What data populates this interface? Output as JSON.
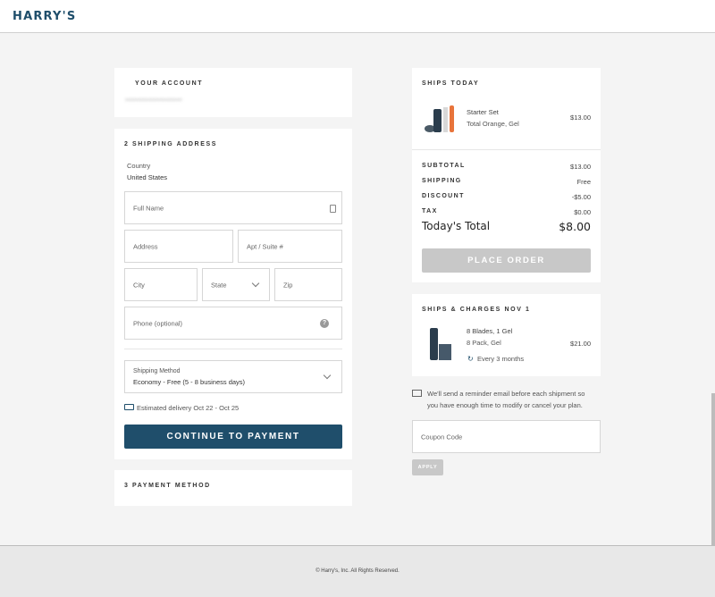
{
  "brand": {
    "logo": "HARRY'S"
  },
  "account": {
    "heading": "YOUR ACCOUNT",
    "email": "••••••••••••••••••••••••••"
  },
  "shipping": {
    "heading": "2  SHIPPING ADDRESS",
    "country_label": "Country",
    "country_value": "United States",
    "full_name_placeholder": "Full Name",
    "address_placeholder": "Address",
    "apt_placeholder": "Apt / Suite #",
    "city_placeholder": "City",
    "state_placeholder": "State",
    "zip_placeholder": "Zip",
    "phone_placeholder": "Phone (optional)",
    "method_label": "Shipping Method",
    "method_value": "Economy - Free (5 - 8 business days)",
    "delivery_estimate": "Estimated delivery Oct 22 - Oct 25",
    "continue_label": "CONTINUE TO PAYMENT"
  },
  "payment": {
    "heading": "3  PAYMENT METHOD"
  },
  "ships_today": {
    "heading": "SHIPS TODAY",
    "item_name": "Starter Set",
    "item_variant": "Total Orange, Gel",
    "item_price": "$13.00",
    "subtotal_label": "SUBTOTAL",
    "subtotal_value": "$13.00",
    "shipping_label": "SHIPPING",
    "shipping_value": "Free",
    "discount_label": "DISCOUNT",
    "discount_value": "-$5.00",
    "tax_label": "TAX",
    "tax_value": "$0.00",
    "total_label": "Today's Total",
    "total_value": "$8.00",
    "place_order_label": "PLACE ORDER"
  },
  "subscription": {
    "heading": "SHIPS & CHARGES NOV 1",
    "item_name": "8 Blades, 1 Gel",
    "item_variant": "8 Pack, Gel",
    "item_price": "$21.00",
    "frequency": "Every 3 months"
  },
  "reminder": {
    "text_line1": "We'll send a reminder email before each shipment so",
    "text_line2": "you have enough time to modify or cancel your plan."
  },
  "coupon": {
    "placeholder": "Coupon Code",
    "apply_label": "APPLY"
  },
  "footer": {
    "copyright": "© Harry's, Inc. All Rights Reserved."
  },
  "colors": {
    "brand": "#1f4e6b",
    "disabled": "#c8c8c8",
    "background": "#f4f4f4"
  }
}
